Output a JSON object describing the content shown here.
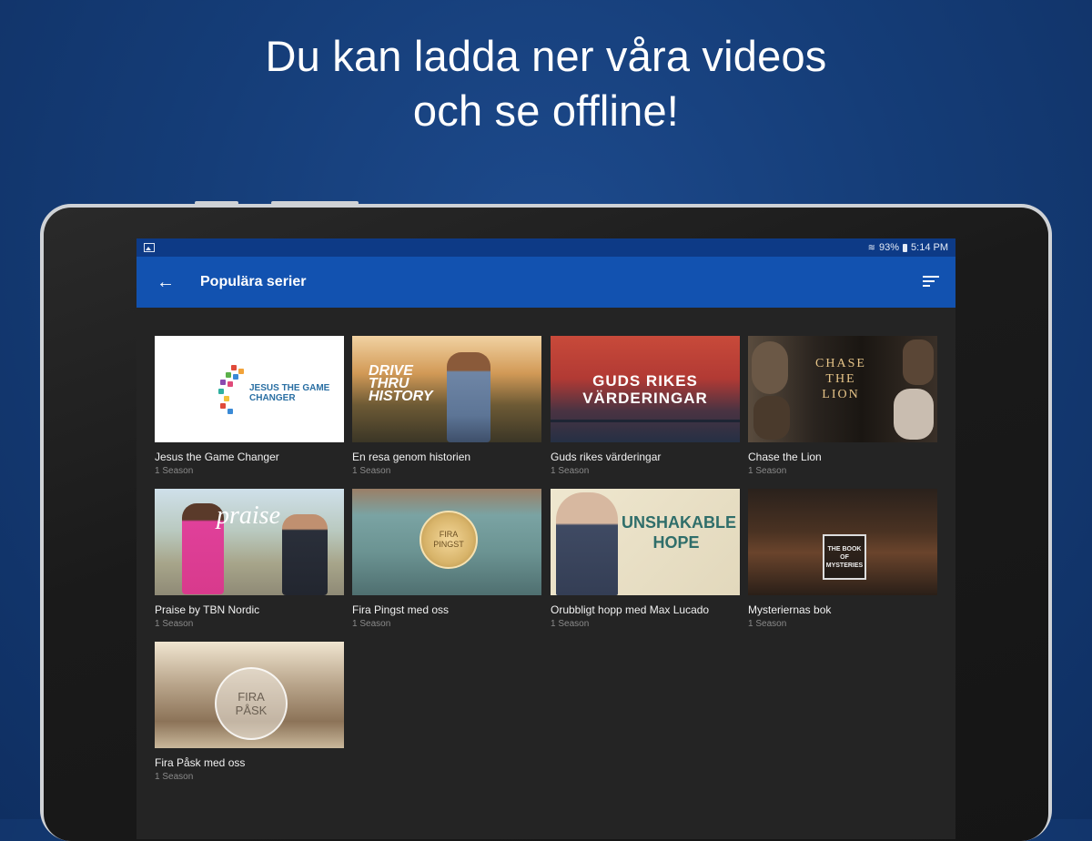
{
  "headline": {
    "line1": "Du kan ladda ner våra videos",
    "line2": "och se offline!"
  },
  "status_bar": {
    "battery": "93%",
    "time": "5:14 PM"
  },
  "app_bar": {
    "title": "Populära serier"
  },
  "series": [
    {
      "title": "Jesus the Game Changer",
      "subtitle": "1 Season",
      "art": "JESUS THE GAME CHANGER"
    },
    {
      "title": "En resa genom historien",
      "subtitle": "1 Season",
      "art": "DRIVE THRU HISTORY"
    },
    {
      "title": "Guds rikes värderingar",
      "subtitle": "1 Season",
      "art": "GUDS RIKES VÄRDERINGAR"
    },
    {
      "title": "Chase the Lion",
      "subtitle": "1 Season",
      "art": "CHASE THE LION"
    },
    {
      "title": "Praise by TBN Nordic",
      "subtitle": "1 Season",
      "art": "praise"
    },
    {
      "title": "Fira Pingst med oss",
      "subtitle": "1 Season",
      "art": "FIRA PINGST"
    },
    {
      "title": "Orubbligt hopp med Max Lucado",
      "subtitle": "1 Season",
      "art": "UNSHAKABLE HOPE"
    },
    {
      "title": "Mysteriernas bok",
      "subtitle": "1 Season",
      "art": "THE BOOK OF MYSTERIES"
    },
    {
      "title": "Fira Påsk med oss",
      "subtitle": "1 Season",
      "art": "FIRA PÅSK"
    }
  ],
  "colors": {
    "background": "#153d78",
    "status_bar": "#0d3a86",
    "app_bar": "#1252b0",
    "screen": "#242424"
  },
  "icons": {
    "back": "arrow-left-icon",
    "sort": "sort-icon",
    "notification": "image-icon"
  }
}
